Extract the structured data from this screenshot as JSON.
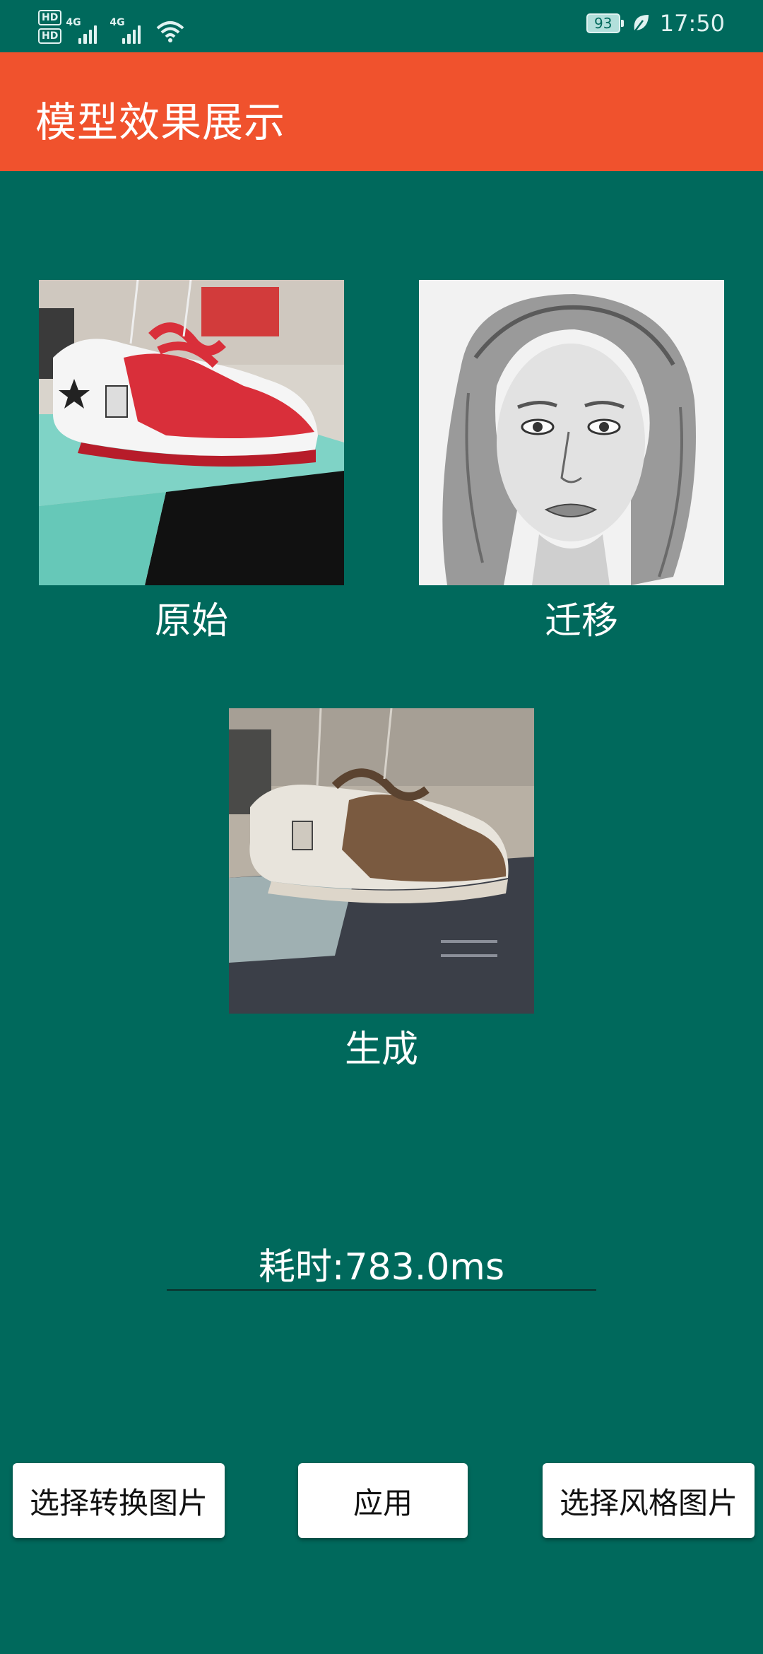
{
  "status_bar": {
    "hd1": "HD",
    "hd2": "HD",
    "net1": "4G",
    "net2": "4G",
    "battery": "93",
    "time": "17:50"
  },
  "app_bar": {
    "title": "模型效果展示"
  },
  "images": {
    "original_label": "原始",
    "style_label": "迁移",
    "generated_label": "生成"
  },
  "timing": {
    "text": "耗时:783.0ms"
  },
  "buttons": {
    "select_content": "选择转换图片",
    "apply": "应用",
    "select_style": "选择风格图片"
  }
}
